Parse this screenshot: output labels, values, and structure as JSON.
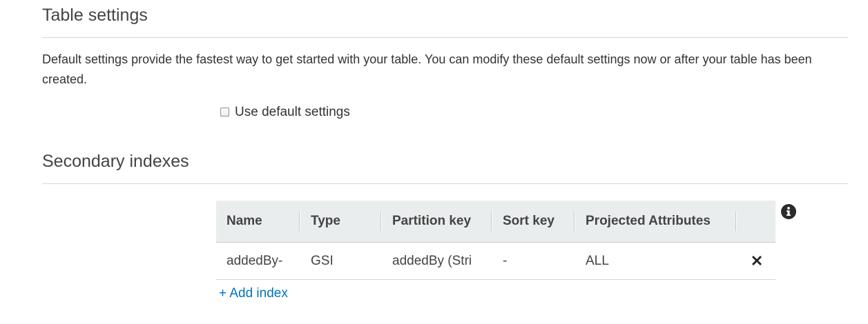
{
  "table_settings": {
    "title": "Table settings",
    "description": "Default settings provide the fastest way to get started with your table. You can modify these default settings now or after your table has been created.",
    "use_default_label": "Use default settings",
    "use_default_checked": false
  },
  "secondary_indexes": {
    "title": "Secondary indexes",
    "columns": [
      "Name",
      "Type",
      "Partition key",
      "Sort key",
      "Projected Attributes"
    ],
    "rows": [
      {
        "name": "addedBy-",
        "type": "GSI",
        "partition_key": "addedBy (Stri",
        "sort_key": "-",
        "projected_attributes": "ALL"
      }
    ],
    "add_index_label": "+ Add index",
    "info_icon": "info-circle-icon",
    "remove_icon": "close-x-icon"
  }
}
